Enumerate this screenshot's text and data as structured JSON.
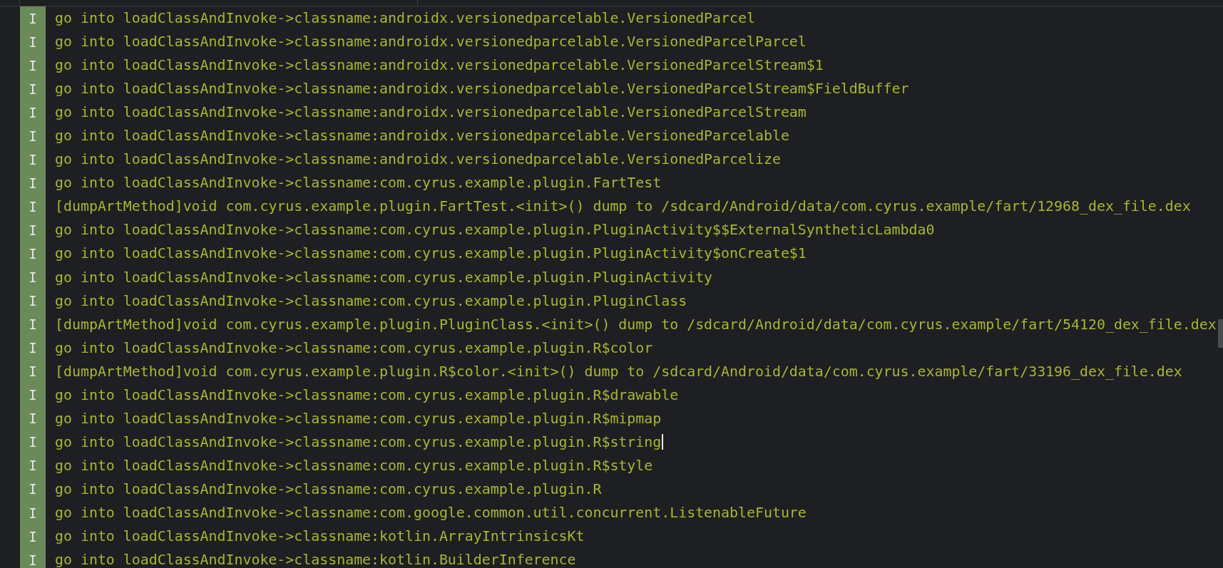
{
  "log_rows": [
    {
      "level": "I",
      "message": "go into loadClassAndInvoke->classname:androidx.versionedparcelable.VersionedParcel",
      "caret": false
    },
    {
      "level": "I",
      "message": "go into loadClassAndInvoke->classname:androidx.versionedparcelable.VersionedParcelParcel",
      "caret": false
    },
    {
      "level": "I",
      "message": "go into loadClassAndInvoke->classname:androidx.versionedparcelable.VersionedParcelStream$1",
      "caret": false
    },
    {
      "level": "I",
      "message": "go into loadClassAndInvoke->classname:androidx.versionedparcelable.VersionedParcelStream$FieldBuffer",
      "caret": false
    },
    {
      "level": "I",
      "message": "go into loadClassAndInvoke->classname:androidx.versionedparcelable.VersionedParcelStream",
      "caret": false
    },
    {
      "level": "I",
      "message": "go into loadClassAndInvoke->classname:androidx.versionedparcelable.VersionedParcelable",
      "caret": false
    },
    {
      "level": "I",
      "message": "go into loadClassAndInvoke->classname:androidx.versionedparcelable.VersionedParcelize",
      "caret": false
    },
    {
      "level": "I",
      "message": "go into loadClassAndInvoke->classname:com.cyrus.example.plugin.FartTest",
      "caret": false
    },
    {
      "level": "I",
      "message": "[dumpArtMethod]void com.cyrus.example.plugin.FartTest.<init>() dump to /sdcard/Android/data/com.cyrus.example/fart/12968_dex_file.dex",
      "caret": false
    },
    {
      "level": "I",
      "message": "go into loadClassAndInvoke->classname:com.cyrus.example.plugin.PluginActivity$$ExternalSyntheticLambda0",
      "caret": false
    },
    {
      "level": "I",
      "message": "go into loadClassAndInvoke->classname:com.cyrus.example.plugin.PluginActivity$onCreate$1",
      "caret": false
    },
    {
      "level": "I",
      "message": "go into loadClassAndInvoke->classname:com.cyrus.example.plugin.PluginActivity",
      "caret": false
    },
    {
      "level": "I",
      "message": "go into loadClassAndInvoke->classname:com.cyrus.example.plugin.PluginClass",
      "caret": false
    },
    {
      "level": "I",
      "message": "[dumpArtMethod]void com.cyrus.example.plugin.PluginClass.<init>() dump to /sdcard/Android/data/com.cyrus.example/fart/54120_dex_file.dex",
      "caret": false
    },
    {
      "level": "I",
      "message": "go into loadClassAndInvoke->classname:com.cyrus.example.plugin.R$color",
      "caret": false
    },
    {
      "level": "I",
      "message": "[dumpArtMethod]void com.cyrus.example.plugin.R$color.<init>() dump to /sdcard/Android/data/com.cyrus.example/fart/33196_dex_file.dex",
      "caret": false
    },
    {
      "level": "I",
      "message": "go into loadClassAndInvoke->classname:com.cyrus.example.plugin.R$drawable",
      "caret": false
    },
    {
      "level": "I",
      "message": "go into loadClassAndInvoke->classname:com.cyrus.example.plugin.R$mipmap",
      "caret": false
    },
    {
      "level": "I",
      "message": "go into loadClassAndInvoke->classname:com.cyrus.example.plugin.R$string",
      "caret": true
    },
    {
      "level": "I",
      "message": "go into loadClassAndInvoke->classname:com.cyrus.example.plugin.R$style",
      "caret": false
    },
    {
      "level": "I",
      "message": "go into loadClassAndInvoke->classname:com.cyrus.example.plugin.R",
      "caret": false
    },
    {
      "level": "I",
      "message": "go into loadClassAndInvoke->classname:com.google.common.util.concurrent.ListenableFuture",
      "caret": false
    },
    {
      "level": "I",
      "message": "go into loadClassAndInvoke->classname:kotlin.ArrayIntrinsicsKt",
      "caret": false
    },
    {
      "level": "I",
      "message": "go into loadClassAndInvoke->classname:kotlin.BuilderInference",
      "caret": false
    }
  ]
}
